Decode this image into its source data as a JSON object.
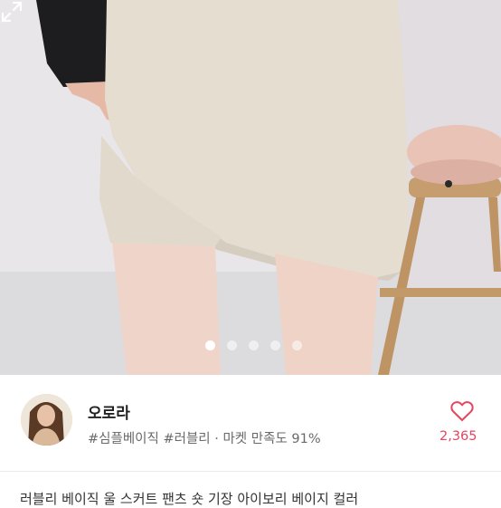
{
  "gallery": {
    "image_alt": "product photo of beige knit skort",
    "page_count": 5,
    "active_index": 0,
    "expand_icon": "expand-icon"
  },
  "seller": {
    "name": "오로라",
    "tags": [
      "#심플베이직",
      "#러블리"
    ],
    "separator": "·",
    "satisfaction": "마켓 만족도 91%"
  },
  "likes": {
    "icon": "heart-icon",
    "count": "2,365",
    "color": "#e5455f"
  },
  "description": {
    "preview": "러블리 베이직 울 스커트 팬츠 숏 기장 아이보리 베이지 컬러"
  }
}
